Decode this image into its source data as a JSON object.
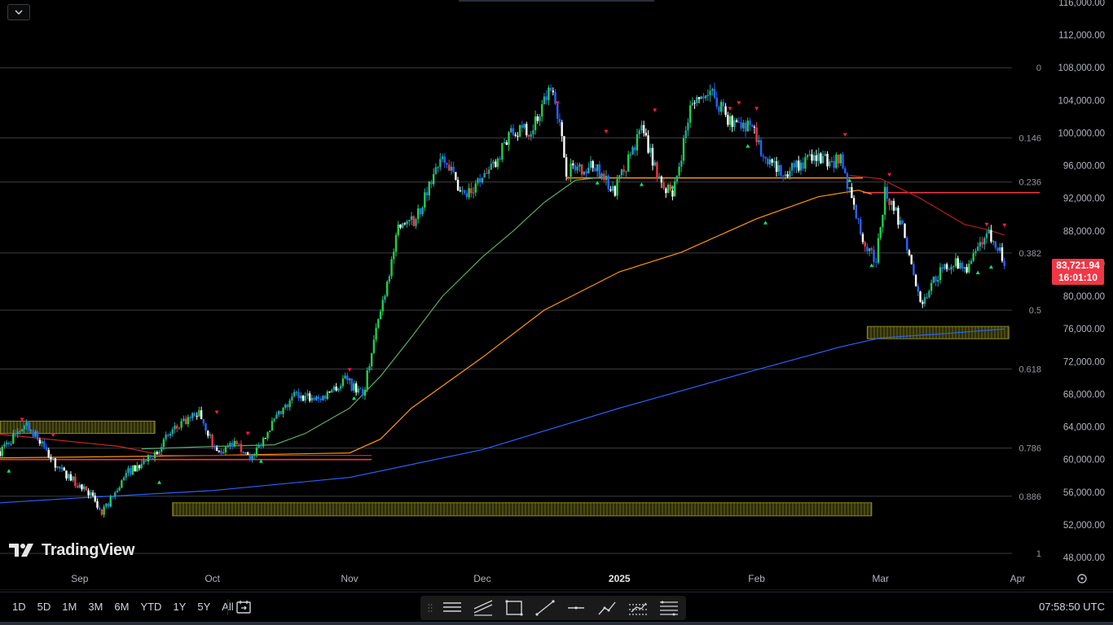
{
  "chart_data": {
    "type": "candlestick",
    "title": "",
    "x_labels": [
      {
        "label": "Sep",
        "date": "2024-09-01"
      },
      {
        "label": "Oct",
        "date": "2024-10-01"
      },
      {
        "label": "Nov",
        "date": "2024-11-01"
      },
      {
        "label": "Dec",
        "date": "2024-12-01"
      },
      {
        "label": "2025",
        "date": "2025-01-01",
        "bold": true
      },
      {
        "label": "Feb",
        "date": "2025-02-01"
      },
      {
        "label": "Mar",
        "date": "2025-03-01"
      },
      {
        "label": "Apr",
        "date": "2025-04-01"
      }
    ],
    "y_ticks": [
      "116,000.00",
      "112,000.00",
      "108,000.00",
      "104,000.00",
      "100,000.00",
      "96,000.00",
      "92,000.00",
      "88,000.00",
      "84,000.00",
      "80,000.00",
      "76,000.00",
      "72,000.00",
      "68,000.00",
      "64,000.00",
      "60,000.00",
      "56,000.00",
      "52,000.00",
      "48,000.00"
    ],
    "y_tick_values": [
      116000,
      112000,
      108000,
      104000,
      100000,
      96000,
      92000,
      88000,
      84000,
      80000,
      76000,
      72000,
      68000,
      64000,
      60000,
      56000,
      52000,
      48000
    ],
    "ylim": [
      46000,
      117000
    ],
    "fib_levels": [
      {
        "label": "0",
        "price": 108000
      },
      {
        "label": "0.146",
        "price": 99400
      },
      {
        "label": "0.236",
        "price": 94000
      },
      {
        "label": "0.382",
        "price": 85300
      },
      {
        "label": "0.5",
        "price": 78300
      },
      {
        "label": "0.618",
        "price": 71100
      },
      {
        "label": "0.786",
        "price": 61400
      },
      {
        "label": "0.886",
        "price": 55500
      },
      {
        "label": "1",
        "price": 48500
      }
    ],
    "zones": [
      {
        "from": "2024-08-14",
        "to": "2024-09-18",
        "low": 63200,
        "high": 64700
      },
      {
        "from": "2024-09-22",
        "to": "2025-02-27",
        "low": 53100,
        "high": 54700
      },
      {
        "from": "2025-02-26",
        "to": "2025-03-30",
        "low": 74800,
        "high": 76300
      }
    ],
    "horizontal_lines": [
      {
        "from": "2024-08-14",
        "to": "2024-11-06",
        "price": 60000,
        "color": "#f23645"
      },
      {
        "from": "2024-12-20",
        "to": "2025-02-25",
        "price": 94500,
        "color": "#ff9800"
      },
      {
        "from": "2025-02-25",
        "to": "2025-04-06",
        "price": 92700,
        "color": "#f23645"
      }
    ],
    "moving_averages": [
      {
        "color": "#5aa86a",
        "points": [
          [
            "2024-09-15",
            61300
          ],
          [
            "2024-10-01",
            61600
          ],
          [
            "2024-10-15",
            61800
          ],
          [
            "2024-10-22",
            63200
          ],
          [
            "2024-11-01",
            66300
          ],
          [
            "2024-11-08",
            70200
          ],
          [
            "2024-11-15",
            75000
          ],
          [
            "2024-11-22",
            80000
          ],
          [
            "2024-12-01",
            84800
          ],
          [
            "2024-12-08",
            88000
          ],
          [
            "2024-12-15",
            91500
          ],
          [
            "2024-12-22",
            94200
          ],
          [
            "2024-12-28",
            94600
          ]
        ]
      },
      {
        "color": "#ff9800",
        "points": [
          [
            "2024-08-14",
            60200
          ],
          [
            "2024-09-01",
            60300
          ],
          [
            "2024-10-01",
            60500
          ],
          [
            "2024-11-01",
            60800
          ],
          [
            "2024-11-08",
            62500
          ],
          [
            "2024-11-15",
            66300
          ],
          [
            "2024-12-01",
            72500
          ],
          [
            "2024-12-15",
            78300
          ],
          [
            "2025-01-01",
            83000
          ],
          [
            "2025-01-15",
            85400
          ],
          [
            "2025-02-01",
            89500
          ],
          [
            "2025-02-15",
            92200
          ],
          [
            "2025-02-24",
            93000
          ],
          [
            "2025-02-27",
            92500
          ]
        ]
      },
      {
        "color": "#c62828",
        "points": [
          [
            "2024-08-14",
            63100
          ],
          [
            "2024-09-10",
            61600
          ],
          [
            "2024-09-20",
            60500
          ],
          [
            "2024-11-06",
            60500
          ]
        ]
      },
      {
        "color": "#b71c1c",
        "points": [
          [
            "2025-02-22",
            94800
          ],
          [
            "2025-03-01",
            94400
          ],
          [
            "2025-03-10",
            92000
          ],
          [
            "2025-03-20",
            88800
          ],
          [
            "2025-03-25",
            88200
          ],
          [
            "2025-03-29",
            87500
          ]
        ]
      },
      {
        "color": "#2962ff",
        "points": [
          [
            "2024-08-14",
            54700
          ],
          [
            "2024-09-01",
            55300
          ],
          [
            "2024-10-01",
            56200
          ],
          [
            "2024-11-01",
            57800
          ],
          [
            "2024-12-01",
            61200
          ],
          [
            "2025-01-01",
            66300
          ],
          [
            "2025-02-01",
            71000
          ],
          [
            "2025-02-20",
            73800
          ],
          [
            "2025-03-01",
            74900
          ],
          [
            "2025-03-15",
            75400
          ],
          [
            "2025-03-29",
            76000
          ]
        ]
      }
    ],
    "candles_per_day": 2,
    "anchors": [
      [
        "2024-08-14",
        61000
      ],
      [
        "2024-08-20",
        64500
      ],
      [
        "2024-08-27",
        59000
      ],
      [
        "2024-09-03",
        56000
      ],
      [
        "2024-09-06",
        53300
      ],
      [
        "2024-09-12",
        58500
      ],
      [
        "2024-09-17",
        60200
      ],
      [
        "2024-09-22",
        63500
      ],
      [
        "2024-09-28",
        65800
      ],
      [
        "2024-10-02",
        60800
      ],
      [
        "2024-10-06",
        61800
      ],
      [
        "2024-10-10",
        60200
      ],
      [
        "2024-10-14",
        64000
      ],
      [
        "2024-10-20",
        68000
      ],
      [
        "2024-10-25",
        67300
      ],
      [
        "2024-10-31",
        69800
      ],
      [
        "2024-11-04",
        67800
      ],
      [
        "2024-11-07",
        75800
      ],
      [
        "2024-11-12",
        88000
      ],
      [
        "2024-11-16",
        89500
      ],
      [
        "2024-11-22",
        97800
      ],
      [
        "2024-11-27",
        92000
      ],
      [
        "2024-12-03",
        95500
      ],
      [
        "2024-12-07",
        99800
      ],
      [
        "2024-12-12",
        100500
      ],
      [
        "2024-12-17",
        106000
      ],
      [
        "2024-12-20",
        95500
      ],
      [
        "2024-12-26",
        96000
      ],
      [
        "2024-12-31",
        93000
      ],
      [
        "2025-01-06",
        100500
      ],
      [
        "2025-01-10",
        94500
      ],
      [
        "2025-01-13",
        92000
      ],
      [
        "2025-01-17",
        103000
      ],
      [
        "2025-01-21",
        105500
      ],
      [
        "2025-01-26",
        101500
      ],
      [
        "2025-01-31",
        101000
      ],
      [
        "2025-02-03",
        96000
      ],
      [
        "2025-02-08",
        95500
      ],
      [
        "2025-02-14",
        97000
      ],
      [
        "2025-02-20",
        96500
      ],
      [
        "2025-02-25",
        87000
      ],
      [
        "2025-02-28",
        84400
      ],
      [
        "2025-03-02",
        92800
      ],
      [
        "2025-03-06",
        88400
      ],
      [
        "2025-03-10",
        79000
      ],
      [
        "2025-03-13",
        82000
      ],
      [
        "2025-03-17",
        84200
      ],
      [
        "2025-03-21",
        83500
      ],
      [
        "2025-03-25",
        88000
      ],
      [
        "2025-03-28",
        85500
      ],
      [
        "2025-03-29",
        83721.94
      ]
    ],
    "signals": [
      {
        "date": "2024-08-16",
        "dir": "up",
        "price": 58600
      },
      {
        "date": "2024-08-19",
        "dir": "down",
        "price": 64900
      },
      {
        "date": "2024-08-26",
        "dir": "down",
        "price": 63000
      },
      {
        "date": "2024-09-19",
        "dir": "up",
        "price": 57200
      },
      {
        "date": "2024-10-02",
        "dir": "down",
        "price": 65800
      },
      {
        "date": "2024-10-09",
        "dir": "down",
        "price": 63200
      },
      {
        "date": "2024-10-12",
        "dir": "up",
        "price": 59800
      },
      {
        "date": "2024-11-01",
        "dir": "down",
        "price": 71000
      },
      {
        "date": "2024-11-02",
        "dir": "up",
        "price": 67500
      },
      {
        "date": "2024-12-18",
        "dir": "down",
        "price": 103700
      },
      {
        "date": "2024-12-27",
        "dir": "up",
        "price": 93900
      },
      {
        "date": "2024-12-29",
        "dir": "down",
        "price": 100200
      },
      {
        "date": "2025-01-06",
        "dir": "up",
        "price": 93700
      },
      {
        "date": "2025-01-09",
        "dir": "down",
        "price": 102800
      },
      {
        "date": "2025-01-13",
        "dir": "up",
        "price": 93400
      },
      {
        "date": "2025-01-26",
        "dir": "down",
        "price": 103000
      },
      {
        "date": "2025-01-28",
        "dir": "down",
        "price": 103700
      },
      {
        "date": "2025-01-30",
        "dir": "up",
        "price": 98400
      },
      {
        "date": "2025-02-01",
        "dir": "down",
        "price": 103000
      },
      {
        "date": "2025-02-03",
        "dir": "up",
        "price": 89000
      },
      {
        "date": "2025-02-21",
        "dir": "down",
        "price": 99800
      },
      {
        "date": "2025-02-22",
        "dir": "up",
        "price": 94200
      },
      {
        "date": "2025-02-27",
        "dir": "up",
        "price": 83800
      },
      {
        "date": "2025-03-03",
        "dir": "down",
        "price": 94900
      },
      {
        "date": "2025-03-23",
        "dir": "up",
        "price": 82900
      },
      {
        "date": "2025-03-25",
        "dir": "down",
        "price": 88800
      },
      {
        "date": "2025-03-26",
        "dir": "up",
        "price": 83600
      },
      {
        "date": "2025-03-29",
        "dir": "down",
        "price": 88700
      }
    ],
    "last_price": "83,721.94",
    "countdown": "16:01:10"
  },
  "logo_text": "TradingView",
  "ranges": [
    "1D",
    "5D",
    "1M",
    "3M",
    "6M",
    "YTD",
    "1Y",
    "5Y",
    "All"
  ],
  "toolbar_icons": [
    "grip-icon",
    "horizontal-lines-icon",
    "trend-channel-icon",
    "rectangle-icon",
    "trend-line-icon",
    "horizontal-line-icon",
    "path-icon",
    "parallel-channel-icon",
    "fib-retracement-icon"
  ],
  "clock": "07:58:50 UTC",
  "colors": {
    "up": "#26a69a",
    "up_strong": "#1fd14a",
    "down": "#2962ff",
    "down_alt": "#ffffff",
    "down_red": "#f23645",
    "grid": "#3a3d45",
    "axis_text": "#b2b5be"
  }
}
